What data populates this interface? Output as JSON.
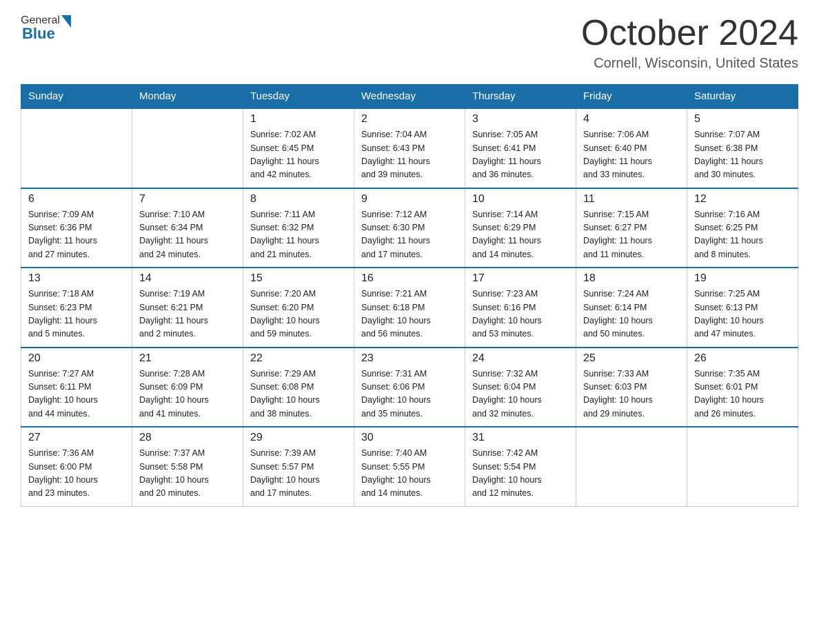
{
  "header": {
    "logo_general": "General",
    "logo_blue": "Blue",
    "month": "October 2024",
    "location": "Cornell, Wisconsin, United States"
  },
  "days_of_week": [
    "Sunday",
    "Monday",
    "Tuesday",
    "Wednesday",
    "Thursday",
    "Friday",
    "Saturday"
  ],
  "weeks": [
    [
      {
        "day": "",
        "info": ""
      },
      {
        "day": "",
        "info": ""
      },
      {
        "day": "1",
        "info": "Sunrise: 7:02 AM\nSunset: 6:45 PM\nDaylight: 11 hours\nand 42 minutes."
      },
      {
        "day": "2",
        "info": "Sunrise: 7:04 AM\nSunset: 6:43 PM\nDaylight: 11 hours\nand 39 minutes."
      },
      {
        "day": "3",
        "info": "Sunrise: 7:05 AM\nSunset: 6:41 PM\nDaylight: 11 hours\nand 36 minutes."
      },
      {
        "day": "4",
        "info": "Sunrise: 7:06 AM\nSunset: 6:40 PM\nDaylight: 11 hours\nand 33 minutes."
      },
      {
        "day": "5",
        "info": "Sunrise: 7:07 AM\nSunset: 6:38 PM\nDaylight: 11 hours\nand 30 minutes."
      }
    ],
    [
      {
        "day": "6",
        "info": "Sunrise: 7:09 AM\nSunset: 6:36 PM\nDaylight: 11 hours\nand 27 minutes."
      },
      {
        "day": "7",
        "info": "Sunrise: 7:10 AM\nSunset: 6:34 PM\nDaylight: 11 hours\nand 24 minutes."
      },
      {
        "day": "8",
        "info": "Sunrise: 7:11 AM\nSunset: 6:32 PM\nDaylight: 11 hours\nand 21 minutes."
      },
      {
        "day": "9",
        "info": "Sunrise: 7:12 AM\nSunset: 6:30 PM\nDaylight: 11 hours\nand 17 minutes."
      },
      {
        "day": "10",
        "info": "Sunrise: 7:14 AM\nSunset: 6:29 PM\nDaylight: 11 hours\nand 14 minutes."
      },
      {
        "day": "11",
        "info": "Sunrise: 7:15 AM\nSunset: 6:27 PM\nDaylight: 11 hours\nand 11 minutes."
      },
      {
        "day": "12",
        "info": "Sunrise: 7:16 AM\nSunset: 6:25 PM\nDaylight: 11 hours\nand 8 minutes."
      }
    ],
    [
      {
        "day": "13",
        "info": "Sunrise: 7:18 AM\nSunset: 6:23 PM\nDaylight: 11 hours\nand 5 minutes."
      },
      {
        "day": "14",
        "info": "Sunrise: 7:19 AM\nSunset: 6:21 PM\nDaylight: 11 hours\nand 2 minutes."
      },
      {
        "day": "15",
        "info": "Sunrise: 7:20 AM\nSunset: 6:20 PM\nDaylight: 10 hours\nand 59 minutes."
      },
      {
        "day": "16",
        "info": "Sunrise: 7:21 AM\nSunset: 6:18 PM\nDaylight: 10 hours\nand 56 minutes."
      },
      {
        "day": "17",
        "info": "Sunrise: 7:23 AM\nSunset: 6:16 PM\nDaylight: 10 hours\nand 53 minutes."
      },
      {
        "day": "18",
        "info": "Sunrise: 7:24 AM\nSunset: 6:14 PM\nDaylight: 10 hours\nand 50 minutes."
      },
      {
        "day": "19",
        "info": "Sunrise: 7:25 AM\nSunset: 6:13 PM\nDaylight: 10 hours\nand 47 minutes."
      }
    ],
    [
      {
        "day": "20",
        "info": "Sunrise: 7:27 AM\nSunset: 6:11 PM\nDaylight: 10 hours\nand 44 minutes."
      },
      {
        "day": "21",
        "info": "Sunrise: 7:28 AM\nSunset: 6:09 PM\nDaylight: 10 hours\nand 41 minutes."
      },
      {
        "day": "22",
        "info": "Sunrise: 7:29 AM\nSunset: 6:08 PM\nDaylight: 10 hours\nand 38 minutes."
      },
      {
        "day": "23",
        "info": "Sunrise: 7:31 AM\nSunset: 6:06 PM\nDaylight: 10 hours\nand 35 minutes."
      },
      {
        "day": "24",
        "info": "Sunrise: 7:32 AM\nSunset: 6:04 PM\nDaylight: 10 hours\nand 32 minutes."
      },
      {
        "day": "25",
        "info": "Sunrise: 7:33 AM\nSunset: 6:03 PM\nDaylight: 10 hours\nand 29 minutes."
      },
      {
        "day": "26",
        "info": "Sunrise: 7:35 AM\nSunset: 6:01 PM\nDaylight: 10 hours\nand 26 minutes."
      }
    ],
    [
      {
        "day": "27",
        "info": "Sunrise: 7:36 AM\nSunset: 6:00 PM\nDaylight: 10 hours\nand 23 minutes."
      },
      {
        "day": "28",
        "info": "Sunrise: 7:37 AM\nSunset: 5:58 PM\nDaylight: 10 hours\nand 20 minutes."
      },
      {
        "day": "29",
        "info": "Sunrise: 7:39 AM\nSunset: 5:57 PM\nDaylight: 10 hours\nand 17 minutes."
      },
      {
        "day": "30",
        "info": "Sunrise: 7:40 AM\nSunset: 5:55 PM\nDaylight: 10 hours\nand 14 minutes."
      },
      {
        "day": "31",
        "info": "Sunrise: 7:42 AM\nSunset: 5:54 PM\nDaylight: 10 hours\nand 12 minutes."
      },
      {
        "day": "",
        "info": ""
      },
      {
        "day": "",
        "info": ""
      }
    ]
  ]
}
